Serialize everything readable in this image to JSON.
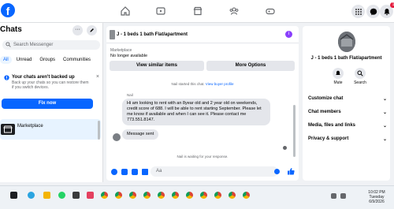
{
  "topbar": {
    "logo_letter": "f",
    "nav_icons": [
      "home-icon",
      "video-icon",
      "marketplace-icon",
      "groups-icon",
      "gaming-icon"
    ],
    "notification_count": "1"
  },
  "sidebar": {
    "title": "Chats",
    "search_placeholder": "Search Messenger",
    "filters": [
      "All",
      "Unread",
      "Groups",
      "Communities"
    ],
    "backup": {
      "title": "Your chats aren't backed up",
      "subtitle": "Back up your chats so you can restore them if you switch devices.",
      "fix_label": "Fix now"
    },
    "conversation_name": "Marketplace"
  },
  "chat": {
    "title": "J - 1 beds 1 bath Flat/apartment",
    "marketplace_label": "Marketplace",
    "availability": "No longer available",
    "view_similar": "View similar items",
    "more_options": "More Options",
    "started_text": "Nail started this chat. ",
    "view_profile": "View buyer profile",
    "sender_name": "Nail",
    "message_1": "Hi am looking to rent with an 8year old and 2 year old on weekends, credit score of 688. I will be able to rent starting September. Please let me know if available and when I can see it. Please contact me 773.551.8147.",
    "message_2": "Message sent",
    "waiting_text": "Nail is waiting for your response.",
    "composer_placeholder": "Aa"
  },
  "right_panel": {
    "title": "J - 1 beds 1 bath Flat/apartment",
    "mute_label": "Mute",
    "search_label": "Search",
    "sections": [
      "Customize chat",
      "Chat members",
      "Media, files and links",
      "Privacy & support"
    ]
  },
  "taskbar": {
    "time": "10:02 PM",
    "day": "Tuesday",
    "date": "6/9/2026"
  },
  "colors": {
    "accent": "#0866ff",
    "bubble": "#e4e6eb",
    "background": "#f0f2f5"
  }
}
